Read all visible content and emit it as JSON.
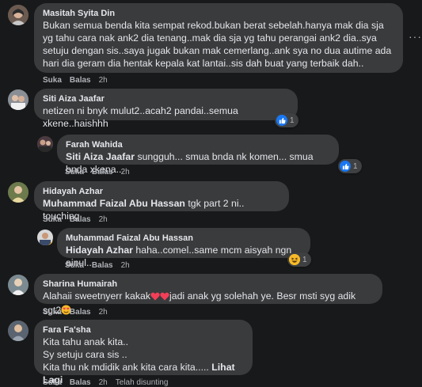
{
  "actions": {
    "like": "Suka",
    "reply": "Balas"
  },
  "comments": [
    {
      "author": "Masitah Syita Din",
      "text": "Bukan semua benda kita sempat rekod.bukan berat sebelah.hanya mak dia sja yg tahu cara nak ank2 dia tenang..mak dia sja yg tahu perangai ank2 dia..sya setuju dengan sis..saya jugak bukan mak cemerlang..ank sya no dua autime ada hari dia geram dia hentak kepala kat lantai..sis dah buat yang terbaik dah..",
      "time": "2h"
    },
    {
      "author": "Siti Aiza Jaafar",
      "text": "netizen ni bnyk mulut2..acah2 pandai..semua xkene..haishhh",
      "time": "2h",
      "reactions": "1"
    },
    {
      "author": "Farah Wahida",
      "mention": "Siti Aiza Jaafar",
      "text": " sungguh... smua bnda nk komen... smua bnda xkena...",
      "time": "2h",
      "reactions": "1"
    },
    {
      "author": "Hidayah Azhar",
      "mention": "Muhammad Faizal Abu Hassan",
      "text": " tgk part 2 ni.. touching",
      "time": "2h"
    },
    {
      "author": "Muhammad Faizal Abu Hassan",
      "mention": "Hidayah Azhar",
      "text": " haha..comel..same mcm aisyah ngn ainul..",
      "time": "2h",
      "reactions": "1"
    },
    {
      "author": "Sharina Humairah",
      "text_a": "Alahaii sweetnyerr kakak",
      "text_b": "jadi anak yg solehah ye. Besr msti syg adik sgt2",
      "time": "2h"
    },
    {
      "author": "Fara Fa'sha",
      "text": "Kita tahu anak kita..\nSy setuju cara sis ..\nKita thu nk mdidik ank kita cara kita.....",
      "more": "Lihat Lagi",
      "time": "2h",
      "edited": "Telah disunting"
    }
  ],
  "colors": {
    "background": "#18191a",
    "bubble": "#3a3b3c",
    "meta": "#b0b3b8",
    "like_blue": "#1877f2",
    "heart_red": "#f33e58"
  },
  "icons": [
    "like-icon",
    "haha-icon",
    "heart-icon",
    "sad-smile-icon",
    "heart-eyes-icon",
    "more-options-icon"
  ]
}
